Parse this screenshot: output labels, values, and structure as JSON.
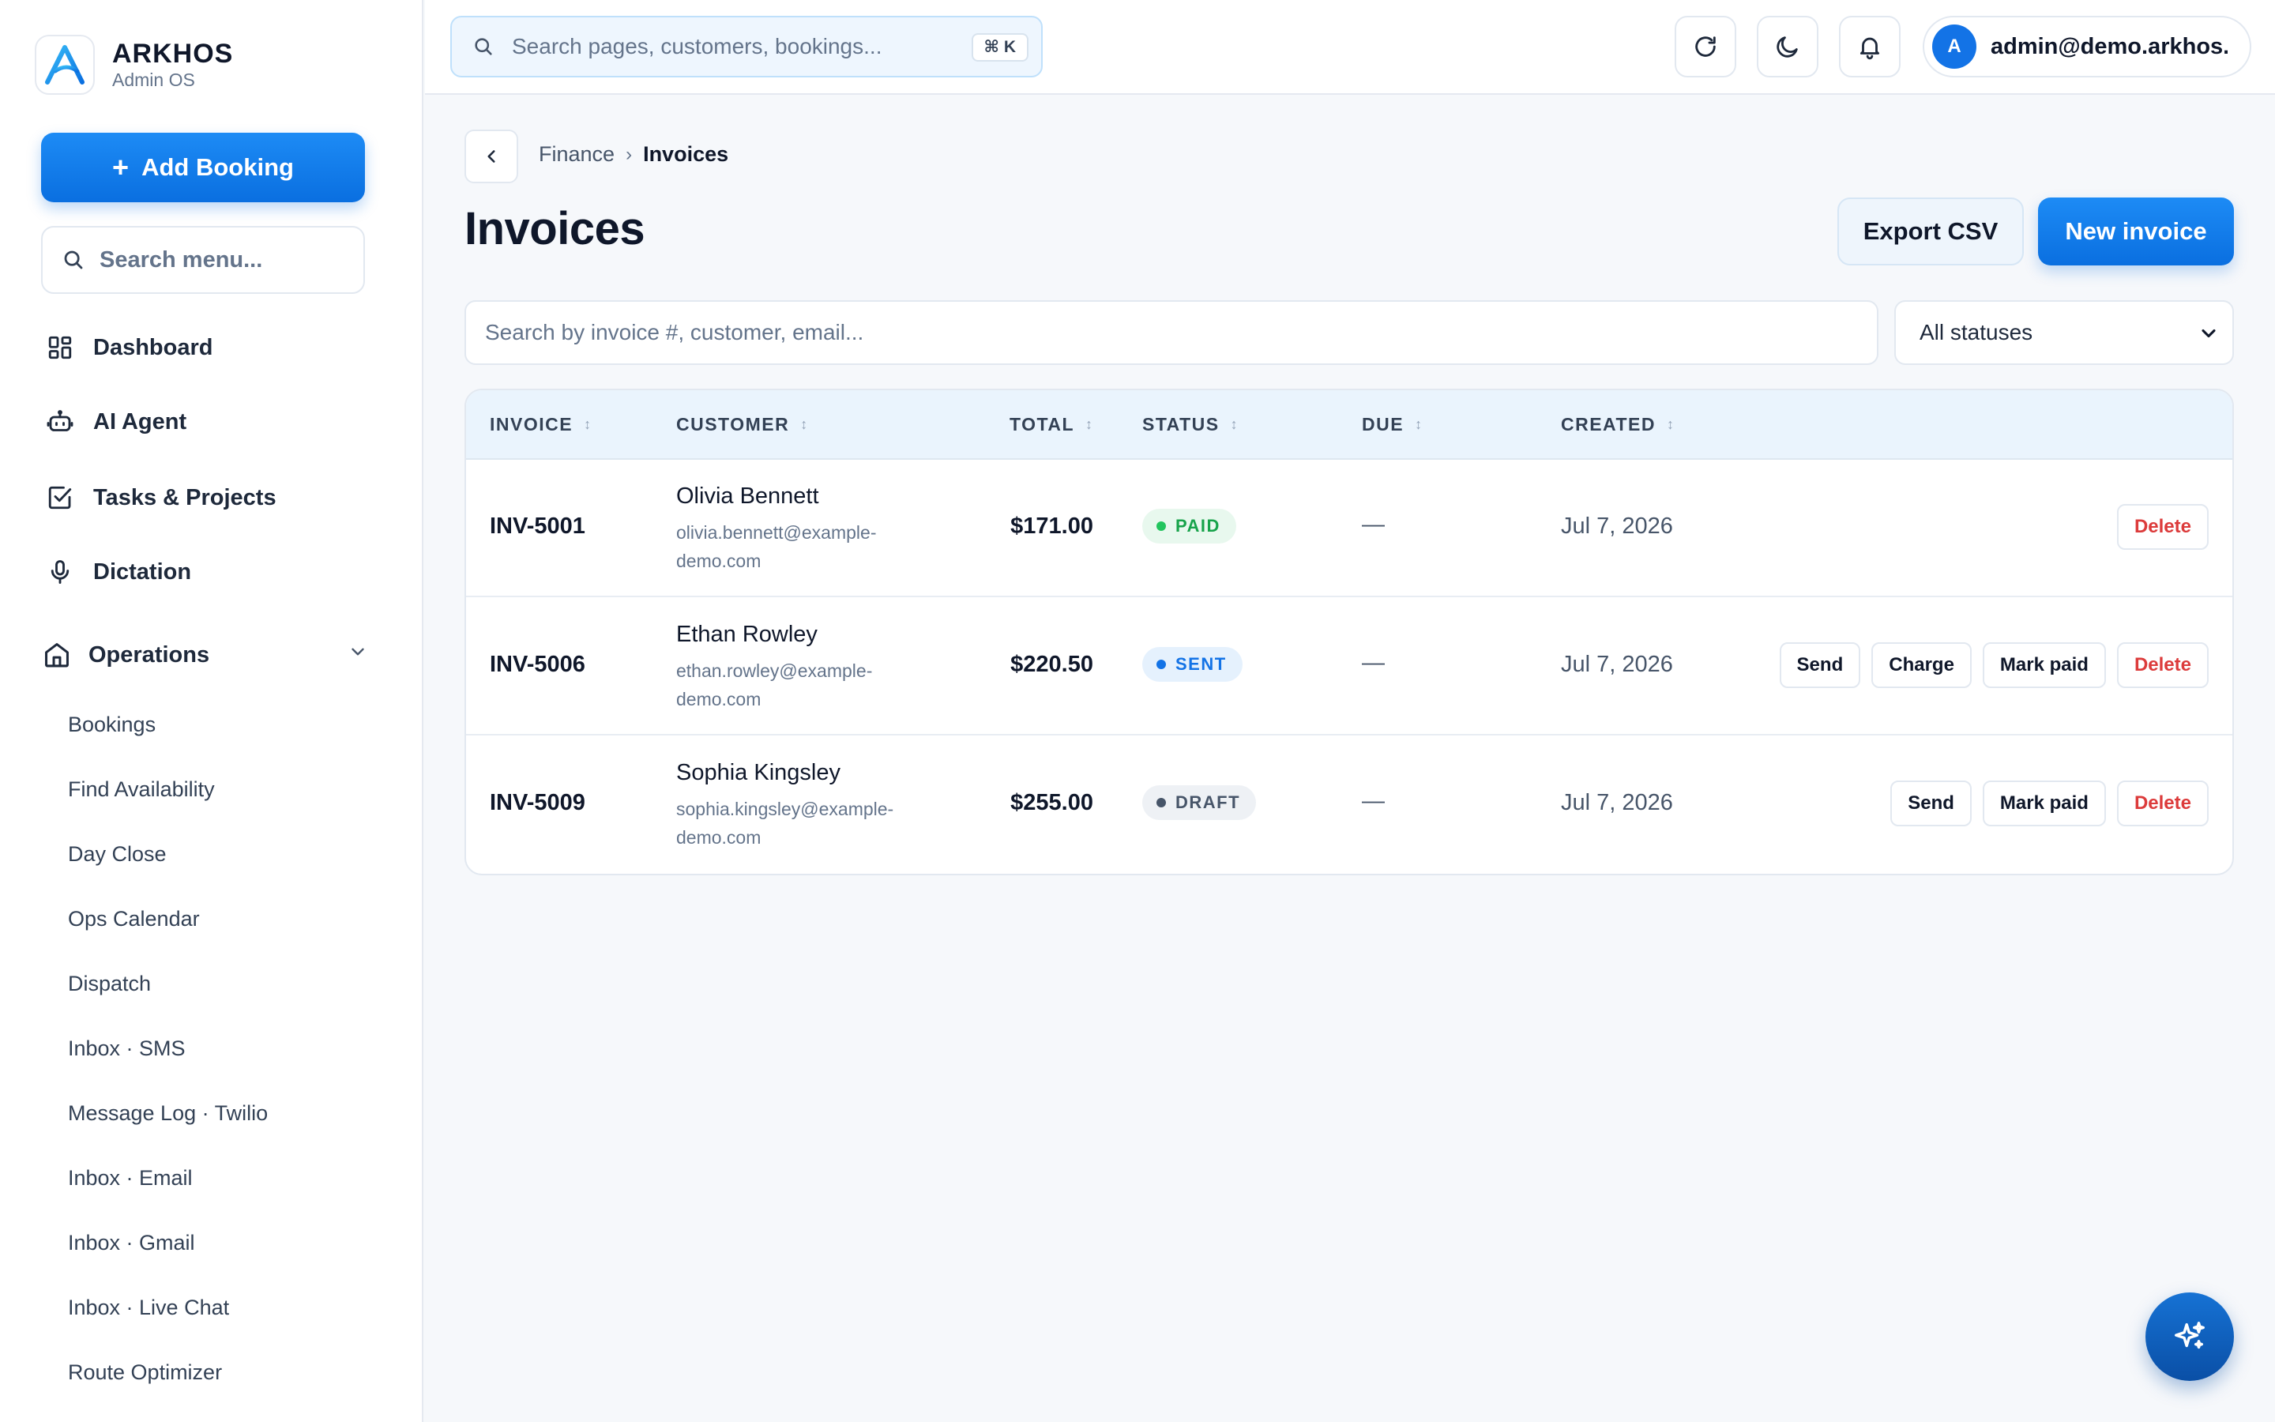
{
  "brand": {
    "name": "ARKHOS",
    "subtitle": "Admin OS"
  },
  "sidebar": {
    "add_booking_label": "Add Booking",
    "search_placeholder": "Search menu...",
    "items": [
      {
        "label": "Dashboard",
        "icon": "dashboard-grid-icon"
      },
      {
        "label": "AI Agent",
        "icon": "robot-icon"
      },
      {
        "label": "Tasks & Projects",
        "icon": "checkbox-icon"
      },
      {
        "label": "Dictation",
        "icon": "microphone-icon"
      }
    ],
    "group": {
      "label": "Operations",
      "icon": "home-icon",
      "expanded": true,
      "children": [
        "Bookings",
        "Find Availability",
        "Day Close",
        "Ops Calendar",
        "Dispatch",
        "Inbox · SMS",
        "Message Log · Twilio",
        "Inbox · Email",
        "Inbox · Gmail",
        "Inbox · Live Chat",
        "Route Optimizer"
      ]
    }
  },
  "topbar": {
    "search_placeholder": "Search pages, customers, bookings...",
    "shortcut": "⌘ K",
    "user": {
      "initial": "A",
      "email": "admin@demo.arkhos.com"
    }
  },
  "breadcrumb": {
    "parent": "Finance",
    "current": "Invoices"
  },
  "page": {
    "title": "Invoices",
    "export_label": "Export CSV",
    "new_label": "New invoice",
    "search_placeholder": "Search by invoice #, customer, email...",
    "status_filter": "All statuses"
  },
  "table": {
    "columns": [
      "INVOICE",
      "CUSTOMER",
      "TOTAL",
      "STATUS",
      "DUE",
      "CREATED"
    ],
    "rows": [
      {
        "invoice": "INV-5001",
        "customer": "Olivia Bennett",
        "email": "olivia.bennett@example-demo.com",
        "total": "$171.00",
        "status": "PAID",
        "due": "—",
        "created": "Jul 7, 2026",
        "actions": [
          "Delete"
        ]
      },
      {
        "invoice": "INV-5006",
        "customer": "Ethan Rowley",
        "email": "ethan.rowley@example-demo.com",
        "total": "$220.50",
        "status": "SENT",
        "due": "—",
        "created": "Jul 7, 2026",
        "actions": [
          "Send",
          "Charge",
          "Mark paid",
          "Delete"
        ]
      },
      {
        "invoice": "INV-5009",
        "customer": "Sophia Kingsley",
        "email": "sophia.kingsley@example-demo.com",
        "total": "$255.00",
        "status": "DRAFT",
        "due": "—",
        "created": "Jul 7, 2026",
        "actions": [
          "Send",
          "Mark paid",
          "Delete"
        ]
      }
    ]
  },
  "colors": {
    "accent": "#1373e6",
    "paid": "#17a34a",
    "sent": "#1373e6",
    "draft": "#475569",
    "danger": "#dc3b3b"
  }
}
